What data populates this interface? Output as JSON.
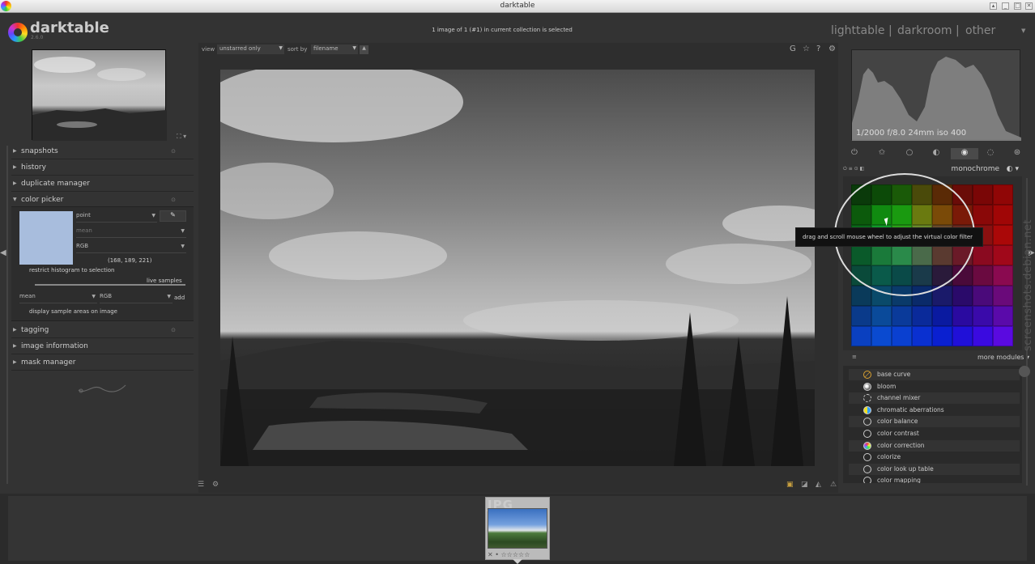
{
  "window": {
    "title": "darktable"
  },
  "header": {
    "logo": "darktable",
    "version": "2.6.0",
    "status": "1 image of 1 (#1) in current collection is selected",
    "views": [
      "lighttable",
      "darkroom",
      "other"
    ],
    "views_sep": "|",
    "views_arrow": "▼"
  },
  "left_panel": {
    "modules": {
      "snapshots": "snapshots",
      "history": "history",
      "duplicate_manager": "duplicate manager",
      "color_picker": "color picker",
      "tagging": "tagging",
      "image_information": "image information",
      "mask_manager": "mask manager"
    },
    "color_picker": {
      "swatch_color": "#a8bddd",
      "mode": "point",
      "statistic": "mean",
      "colorspace": "RGB",
      "values": "(168, 189, 221)",
      "restrict_label": "restrict histogram to selection",
      "live_samples_label": "live samples",
      "sample_statistic": "mean",
      "sample_colorspace": "RGB",
      "add_label": "add",
      "display_samples_label": "display sample areas on image"
    }
  },
  "center": {
    "view_label": "view",
    "view_value": "unstarred only",
    "sort_label": "sort by",
    "sort_value": "filename",
    "tools": [
      "G",
      "☆",
      "?",
      "⚙"
    ]
  },
  "right_panel": {
    "exif": "1/2000 f/8.0 24mm iso 400",
    "module_instance": "monochrome",
    "tooltip": "drag and scroll mouse wheel to adjust the virtual color filter",
    "more_modules_label": "more modules",
    "modules_list": [
      "base curve",
      "bloom",
      "channel mixer",
      "chromatic aberrations",
      "color balance",
      "color contrast",
      "color correction",
      "colorize",
      "color look up table",
      "color mapping"
    ],
    "watermark": "screenshots.debian.net",
    "grid_colors": [
      "#0a3a0a",
      "#0c4a08",
      "#1a5a08",
      "#4a4a0a",
      "#5a2a06",
      "#6a0c08",
      "#7a0606",
      "#900606",
      "#0c5a0c",
      "#108a10",
      "#1a9a10",
      "#6a7a10",
      "#7a4a08",
      "#7a1a08",
      "#8a0808",
      "#a00606",
      "#0a6a1a",
      "#109a28",
      "#2aa018",
      "#6a8a2a",
      "#6a4a2a",
      "#6a2a20",
      "#8a1010",
      "#aa0808",
      "#0a5a2a",
      "#1a7a3a",
      "#2a8a4a",
      "#4a6a4a",
      "#5a3a30",
      "#6a1a28",
      "#8a0a20",
      "#a0081a",
      "#0a4a3a",
      "#0a5a4a",
      "#0a4a48",
      "#1a3a4a",
      "#2a1a3a",
      "#4a0a3a",
      "#6a0a40",
      "#8a0a50",
      "#0a3a5a",
      "#0a4a6a",
      "#0a3a6a",
      "#0a2a6a",
      "#1a1a6a",
      "#2a0a6a",
      "#4a0a7a",
      "#6a0a7a",
      "#0a3a8a",
      "#0a4a9a",
      "#0a3a9a",
      "#0a2a9a",
      "#0a1aa0",
      "#2a0aa0",
      "#3a0aaa",
      "#5a0aaa",
      "#0a40c0",
      "#0a4ad0",
      "#0a40d0",
      "#0a30d0",
      "#0a20d0",
      "#2010d8",
      "#3a0ae0",
      "#5a0ae0"
    ]
  },
  "filmstrip": {
    "type_label": "JPG",
    "stars": "✕ • ☆☆☆☆☆"
  }
}
